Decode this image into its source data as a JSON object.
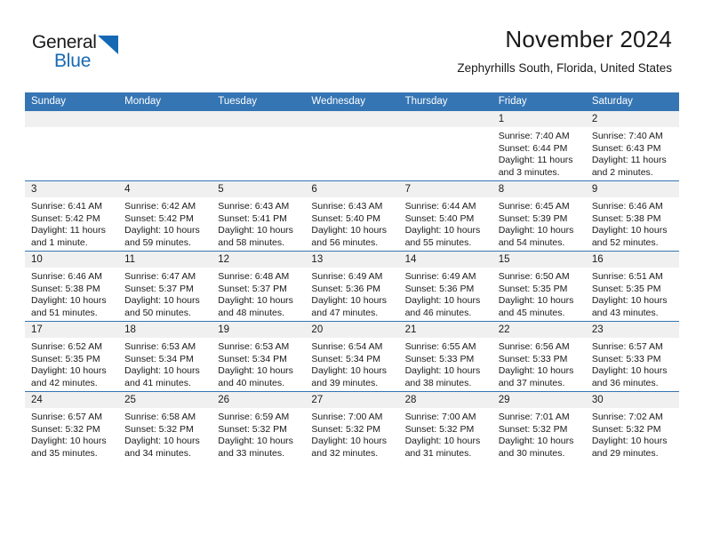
{
  "brand": {
    "word_one": "General",
    "word_two": "Blue",
    "triangle_color": "#1569b4"
  },
  "header": {
    "title": "November 2024",
    "subtitle": "Zephyrhills South, Florida, United States",
    "accent_color": "#3575b4",
    "daynum_bg": "#f0f0f0"
  },
  "calendar": {
    "weekday_headers": [
      "Sunday",
      "Monday",
      "Tuesday",
      "Wednesday",
      "Thursday",
      "Friday",
      "Saturday"
    ],
    "weeks": [
      [
        {
          "day": "",
          "sunrise": "",
          "sunset": "",
          "daylight_a": "",
          "daylight_b": "",
          "empty": true
        },
        {
          "day": "",
          "sunrise": "",
          "sunset": "",
          "daylight_a": "",
          "daylight_b": "",
          "empty": true
        },
        {
          "day": "",
          "sunrise": "",
          "sunset": "",
          "daylight_a": "",
          "daylight_b": "",
          "empty": true
        },
        {
          "day": "",
          "sunrise": "",
          "sunset": "",
          "daylight_a": "",
          "daylight_b": "",
          "empty": true
        },
        {
          "day": "",
          "sunrise": "",
          "sunset": "",
          "daylight_a": "",
          "daylight_b": "",
          "empty": true
        },
        {
          "day": "1",
          "sunrise": "Sunrise: 7:40 AM",
          "sunset": "Sunset: 6:44 PM",
          "daylight_a": "Daylight: 11 hours",
          "daylight_b": "and 3 minutes.",
          "empty": false
        },
        {
          "day": "2",
          "sunrise": "Sunrise: 7:40 AM",
          "sunset": "Sunset: 6:43 PM",
          "daylight_a": "Daylight: 11 hours",
          "daylight_b": "and 2 minutes.",
          "empty": false
        }
      ],
      [
        {
          "day": "3",
          "sunrise": "Sunrise: 6:41 AM",
          "sunset": "Sunset: 5:42 PM",
          "daylight_a": "Daylight: 11 hours",
          "daylight_b": "and 1 minute.",
          "empty": false
        },
        {
          "day": "4",
          "sunrise": "Sunrise: 6:42 AM",
          "sunset": "Sunset: 5:42 PM",
          "daylight_a": "Daylight: 10 hours",
          "daylight_b": "and 59 minutes.",
          "empty": false
        },
        {
          "day": "5",
          "sunrise": "Sunrise: 6:43 AM",
          "sunset": "Sunset: 5:41 PM",
          "daylight_a": "Daylight: 10 hours",
          "daylight_b": "and 58 minutes.",
          "empty": false
        },
        {
          "day": "6",
          "sunrise": "Sunrise: 6:43 AM",
          "sunset": "Sunset: 5:40 PM",
          "daylight_a": "Daylight: 10 hours",
          "daylight_b": "and 56 minutes.",
          "empty": false
        },
        {
          "day": "7",
          "sunrise": "Sunrise: 6:44 AM",
          "sunset": "Sunset: 5:40 PM",
          "daylight_a": "Daylight: 10 hours",
          "daylight_b": "and 55 minutes.",
          "empty": false
        },
        {
          "day": "8",
          "sunrise": "Sunrise: 6:45 AM",
          "sunset": "Sunset: 5:39 PM",
          "daylight_a": "Daylight: 10 hours",
          "daylight_b": "and 54 minutes.",
          "empty": false
        },
        {
          "day": "9",
          "sunrise": "Sunrise: 6:46 AM",
          "sunset": "Sunset: 5:38 PM",
          "daylight_a": "Daylight: 10 hours",
          "daylight_b": "and 52 minutes.",
          "empty": false
        }
      ],
      [
        {
          "day": "10",
          "sunrise": "Sunrise: 6:46 AM",
          "sunset": "Sunset: 5:38 PM",
          "daylight_a": "Daylight: 10 hours",
          "daylight_b": "and 51 minutes.",
          "empty": false
        },
        {
          "day": "11",
          "sunrise": "Sunrise: 6:47 AM",
          "sunset": "Sunset: 5:37 PM",
          "daylight_a": "Daylight: 10 hours",
          "daylight_b": "and 50 minutes.",
          "empty": false
        },
        {
          "day": "12",
          "sunrise": "Sunrise: 6:48 AM",
          "sunset": "Sunset: 5:37 PM",
          "daylight_a": "Daylight: 10 hours",
          "daylight_b": "and 48 minutes.",
          "empty": false
        },
        {
          "day": "13",
          "sunrise": "Sunrise: 6:49 AM",
          "sunset": "Sunset: 5:36 PM",
          "daylight_a": "Daylight: 10 hours",
          "daylight_b": "and 47 minutes.",
          "empty": false
        },
        {
          "day": "14",
          "sunrise": "Sunrise: 6:49 AM",
          "sunset": "Sunset: 5:36 PM",
          "daylight_a": "Daylight: 10 hours",
          "daylight_b": "and 46 minutes.",
          "empty": false
        },
        {
          "day": "15",
          "sunrise": "Sunrise: 6:50 AM",
          "sunset": "Sunset: 5:35 PM",
          "daylight_a": "Daylight: 10 hours",
          "daylight_b": "and 45 minutes.",
          "empty": false
        },
        {
          "day": "16",
          "sunrise": "Sunrise: 6:51 AM",
          "sunset": "Sunset: 5:35 PM",
          "daylight_a": "Daylight: 10 hours",
          "daylight_b": "and 43 minutes.",
          "empty": false
        }
      ],
      [
        {
          "day": "17",
          "sunrise": "Sunrise: 6:52 AM",
          "sunset": "Sunset: 5:35 PM",
          "daylight_a": "Daylight: 10 hours",
          "daylight_b": "and 42 minutes.",
          "empty": false
        },
        {
          "day": "18",
          "sunrise": "Sunrise: 6:53 AM",
          "sunset": "Sunset: 5:34 PM",
          "daylight_a": "Daylight: 10 hours",
          "daylight_b": "and 41 minutes.",
          "empty": false
        },
        {
          "day": "19",
          "sunrise": "Sunrise: 6:53 AM",
          "sunset": "Sunset: 5:34 PM",
          "daylight_a": "Daylight: 10 hours",
          "daylight_b": "and 40 minutes.",
          "empty": false
        },
        {
          "day": "20",
          "sunrise": "Sunrise: 6:54 AM",
          "sunset": "Sunset: 5:34 PM",
          "daylight_a": "Daylight: 10 hours",
          "daylight_b": "and 39 minutes.",
          "empty": false
        },
        {
          "day": "21",
          "sunrise": "Sunrise: 6:55 AM",
          "sunset": "Sunset: 5:33 PM",
          "daylight_a": "Daylight: 10 hours",
          "daylight_b": "and 38 minutes.",
          "empty": false
        },
        {
          "day": "22",
          "sunrise": "Sunrise: 6:56 AM",
          "sunset": "Sunset: 5:33 PM",
          "daylight_a": "Daylight: 10 hours",
          "daylight_b": "and 37 minutes.",
          "empty": false
        },
        {
          "day": "23",
          "sunrise": "Sunrise: 6:57 AM",
          "sunset": "Sunset: 5:33 PM",
          "daylight_a": "Daylight: 10 hours",
          "daylight_b": "and 36 minutes.",
          "empty": false
        }
      ],
      [
        {
          "day": "24",
          "sunrise": "Sunrise: 6:57 AM",
          "sunset": "Sunset: 5:32 PM",
          "daylight_a": "Daylight: 10 hours",
          "daylight_b": "and 35 minutes.",
          "empty": false
        },
        {
          "day": "25",
          "sunrise": "Sunrise: 6:58 AM",
          "sunset": "Sunset: 5:32 PM",
          "daylight_a": "Daylight: 10 hours",
          "daylight_b": "and 34 minutes.",
          "empty": false
        },
        {
          "day": "26",
          "sunrise": "Sunrise: 6:59 AM",
          "sunset": "Sunset: 5:32 PM",
          "daylight_a": "Daylight: 10 hours",
          "daylight_b": "and 33 minutes.",
          "empty": false
        },
        {
          "day": "27",
          "sunrise": "Sunrise: 7:00 AM",
          "sunset": "Sunset: 5:32 PM",
          "daylight_a": "Daylight: 10 hours",
          "daylight_b": "and 32 minutes.",
          "empty": false
        },
        {
          "day": "28",
          "sunrise": "Sunrise: 7:00 AM",
          "sunset": "Sunset: 5:32 PM",
          "daylight_a": "Daylight: 10 hours",
          "daylight_b": "and 31 minutes.",
          "empty": false
        },
        {
          "day": "29",
          "sunrise": "Sunrise: 7:01 AM",
          "sunset": "Sunset: 5:32 PM",
          "daylight_a": "Daylight: 10 hours",
          "daylight_b": "and 30 minutes.",
          "empty": false
        },
        {
          "day": "30",
          "sunrise": "Sunrise: 7:02 AM",
          "sunset": "Sunset: 5:32 PM",
          "daylight_a": "Daylight: 10 hours",
          "daylight_b": "and 29 minutes.",
          "empty": false
        }
      ]
    ]
  }
}
